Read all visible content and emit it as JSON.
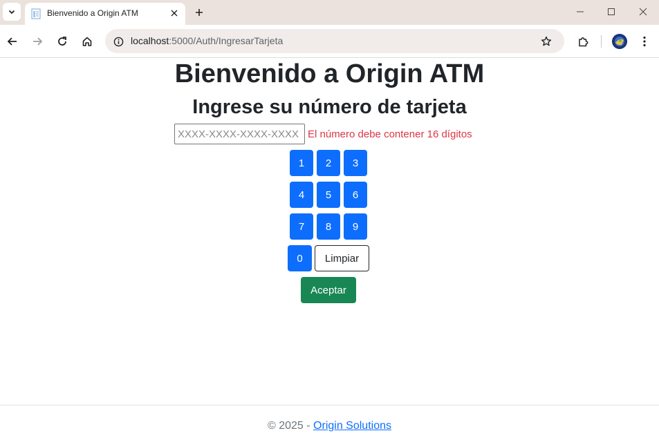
{
  "browser": {
    "tab_title": "Bienvenido a Origin ATM",
    "url_host": "localhost",
    "url_path": ":5000/Auth/IngresarTarjeta"
  },
  "page": {
    "title": "Bienvenido a Origin ATM",
    "subtitle": "Ingrese su número de tarjeta",
    "card_input": {
      "placeholder": "XXXX-XXXX-XXXX-XXXX",
      "value": ""
    },
    "error_message": "El número debe contener 16 dígitos",
    "keypad": {
      "keys": [
        "1",
        "2",
        "3",
        "4",
        "5",
        "6",
        "7",
        "8",
        "9",
        "0"
      ],
      "clear_label": "Limpiar",
      "accept_label": "Aceptar"
    }
  },
  "footer": {
    "prefix": "© 2025 - ",
    "link_text": "Origin Solutions"
  },
  "colors": {
    "primary": "#0d6efd",
    "success": "#198754",
    "danger": "#dc3545",
    "text": "#212529"
  }
}
